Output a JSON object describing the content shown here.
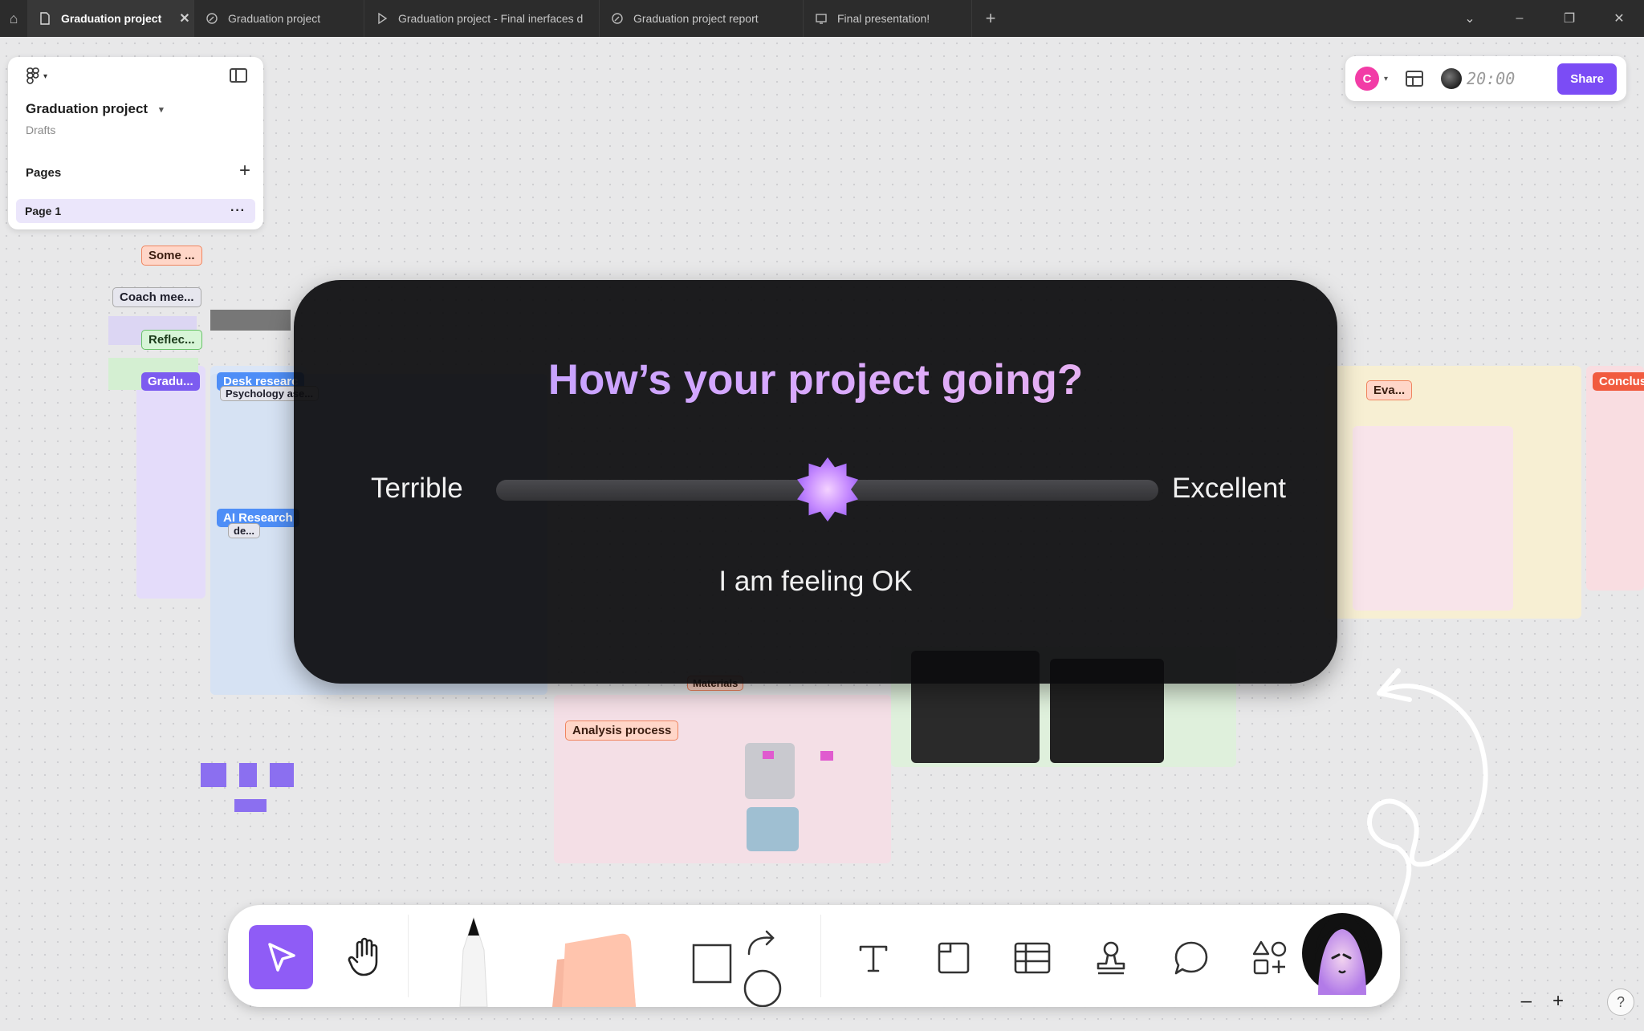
{
  "tabs": [
    {
      "label": "Graduation project",
      "icon": "file-icon",
      "active": true
    },
    {
      "label": "Graduation project",
      "icon": "pen-file-icon",
      "active": false
    },
    {
      "label": "Graduation project - Final inerfaces d",
      "icon": "play-icon",
      "active": false
    },
    {
      "label": "Graduation project report",
      "icon": "pen-file-icon",
      "active": false
    },
    {
      "label": "Final presentation!",
      "icon": "slides-icon",
      "active": false
    }
  ],
  "file_panel": {
    "title": "Graduation project",
    "location": "Drafts",
    "pages_heading": "Pages",
    "pages": [
      {
        "label": "Page 1",
        "more": "···"
      }
    ]
  },
  "top_right": {
    "avatar_letter": "C",
    "timer": "20:00",
    "share_label": "Share"
  },
  "board_labels": {
    "some": "Some ...",
    "coach": "Coach mee...",
    "reflec": "Reflec...",
    "gradu": "Gradu...",
    "desk": "Desk researc",
    "psych": "Psychology ase...",
    "ai": "AI Research",
    "de": "de...",
    "eva": "Eva...",
    "conclus": "Conclus",
    "analysis": "Analysis process",
    "materials": "Materials"
  },
  "modal": {
    "question": "How’s your project going?",
    "left_label": "Terrible",
    "right_label": "Excellent",
    "feeling": "I am feeling OK",
    "slider_value": 0.5
  },
  "toolbar": {
    "tools": [
      "select-tool",
      "hand-tool",
      "pen-tool",
      "sticky-note-tool",
      "shape-tool",
      "text-tool",
      "section-tool",
      "table-tool",
      "stamp-tool",
      "comment-tool",
      "widgets-tool",
      "avatar"
    ]
  },
  "zoom": {
    "minus": "–",
    "plus": "+",
    "help": "?"
  },
  "colors": {
    "accent": "#8f5cf6",
    "share": "#7b4cf5",
    "tabbar": "#2c2c2c"
  }
}
